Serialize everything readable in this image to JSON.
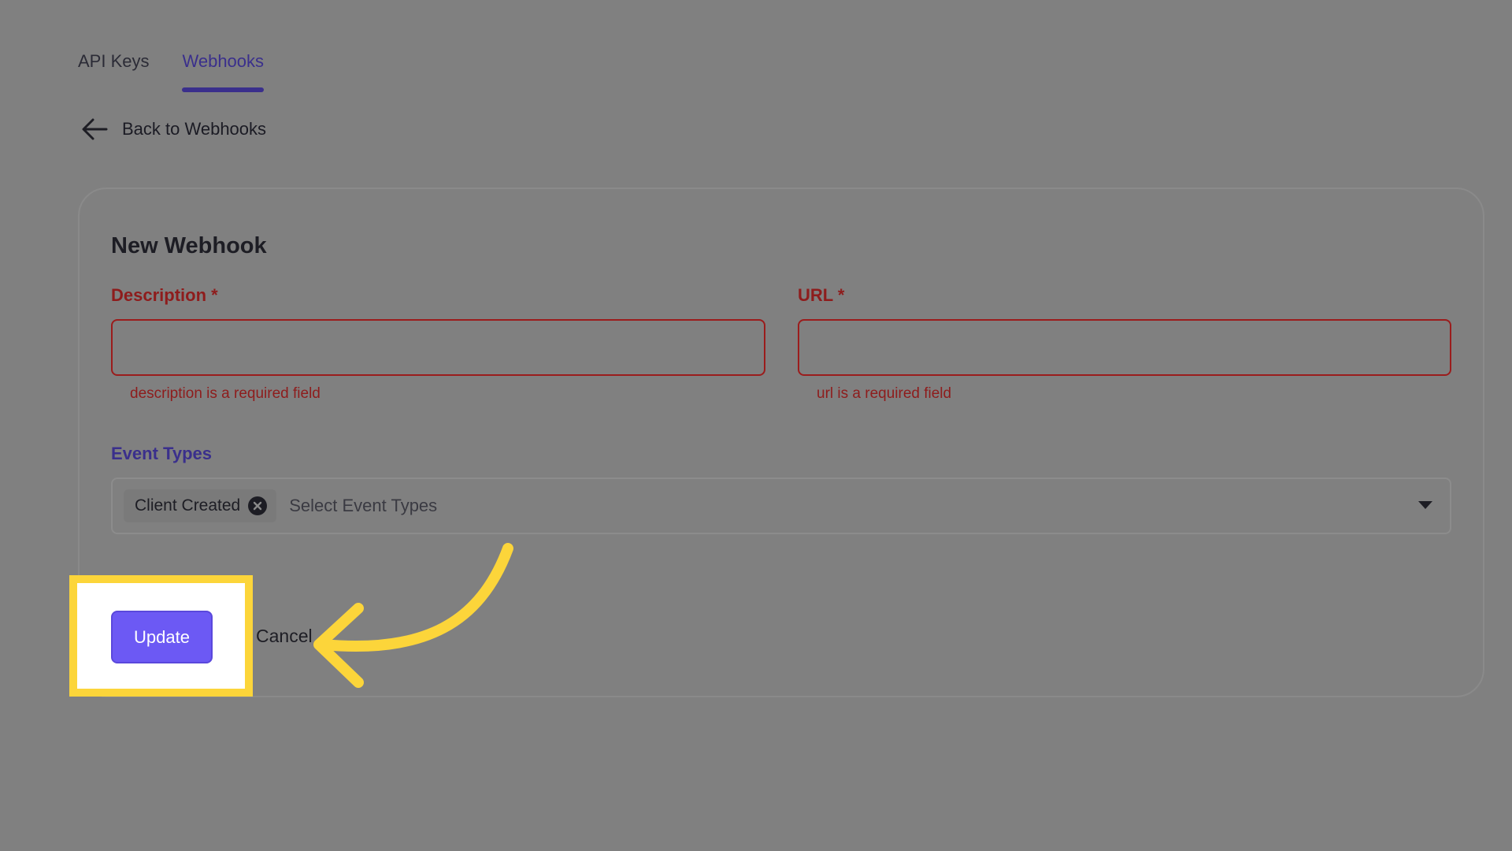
{
  "tabs": [
    {
      "label": "API Keys",
      "active": false
    },
    {
      "label": "Webhooks",
      "active": true
    }
  ],
  "back_link": {
    "label": "Back to Webhooks",
    "icon": "arrow-left-icon"
  },
  "form": {
    "title": "New Webhook",
    "description": {
      "label": "Description *",
      "value": "",
      "error": "description is a required field"
    },
    "url": {
      "label": "URL *",
      "value": "",
      "error": "url is a required field"
    },
    "event_types": {
      "label": "Event Types",
      "selected": [
        {
          "label": "Client Created",
          "remove_icon": "close-circle-icon"
        }
      ],
      "placeholder": "Select Event Types",
      "dropdown_icon": "caret-down-icon"
    },
    "actions": {
      "update_label": "Update",
      "cancel_label": "Cancel"
    }
  },
  "colors": {
    "accent": "#6c59f4",
    "active_tab": "#3a2f8c",
    "error": "#8e1c1c",
    "overlay": "#808080",
    "highlight": "#fcd53a"
  }
}
